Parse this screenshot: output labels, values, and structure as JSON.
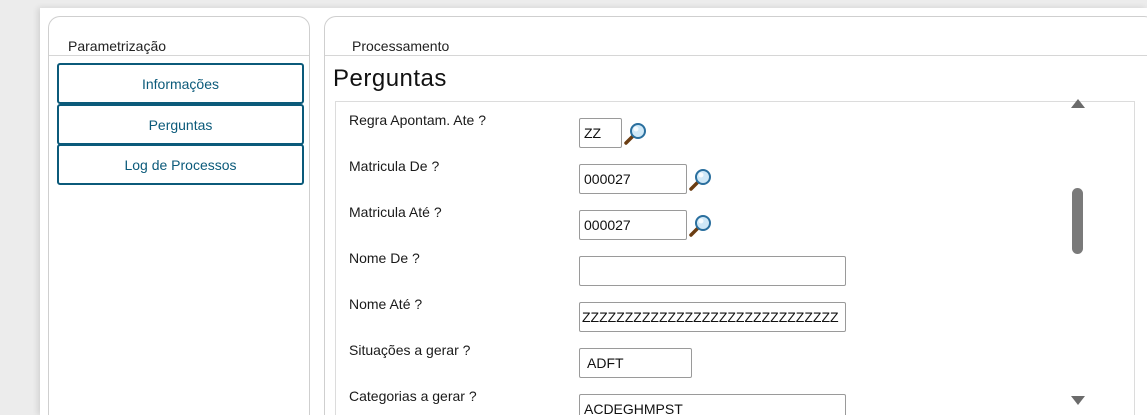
{
  "sidebar": {
    "title": "Parametrização",
    "items": [
      {
        "label": "Informações"
      },
      {
        "label": "Perguntas"
      },
      {
        "label": "Log de Processos"
      }
    ]
  },
  "main": {
    "panel_title": "Processamento",
    "heading": "Perguntas",
    "questions": [
      {
        "label": "Regra Apontam. Ate ?",
        "value": "ZZ"
      },
      {
        "label": "Matricula De ?",
        "value": "000027"
      },
      {
        "label": "Matricula Até ?",
        "value": "000027"
      },
      {
        "label": "Nome De ?",
        "value": ""
      },
      {
        "label": "Nome Até ?",
        "value": "ZZZZZZZZZZZZZZZZZZZZZZZZZZZZZZ"
      },
      {
        "label": "Situações a gerar ?",
        "value": "ADFT"
      },
      {
        "label": "Categorias a gerar ?",
        "value": "ACDEGHMPST"
      }
    ]
  },
  "icons": {
    "lookup": "magnifier-icon",
    "scroll_up": "arrow-up-icon",
    "scroll_down": "arrow-down-icon"
  },
  "colors": {
    "accent": "#0b5a7a",
    "border": "#9a9a9a",
    "scrollbar": "#6b6b6b"
  }
}
